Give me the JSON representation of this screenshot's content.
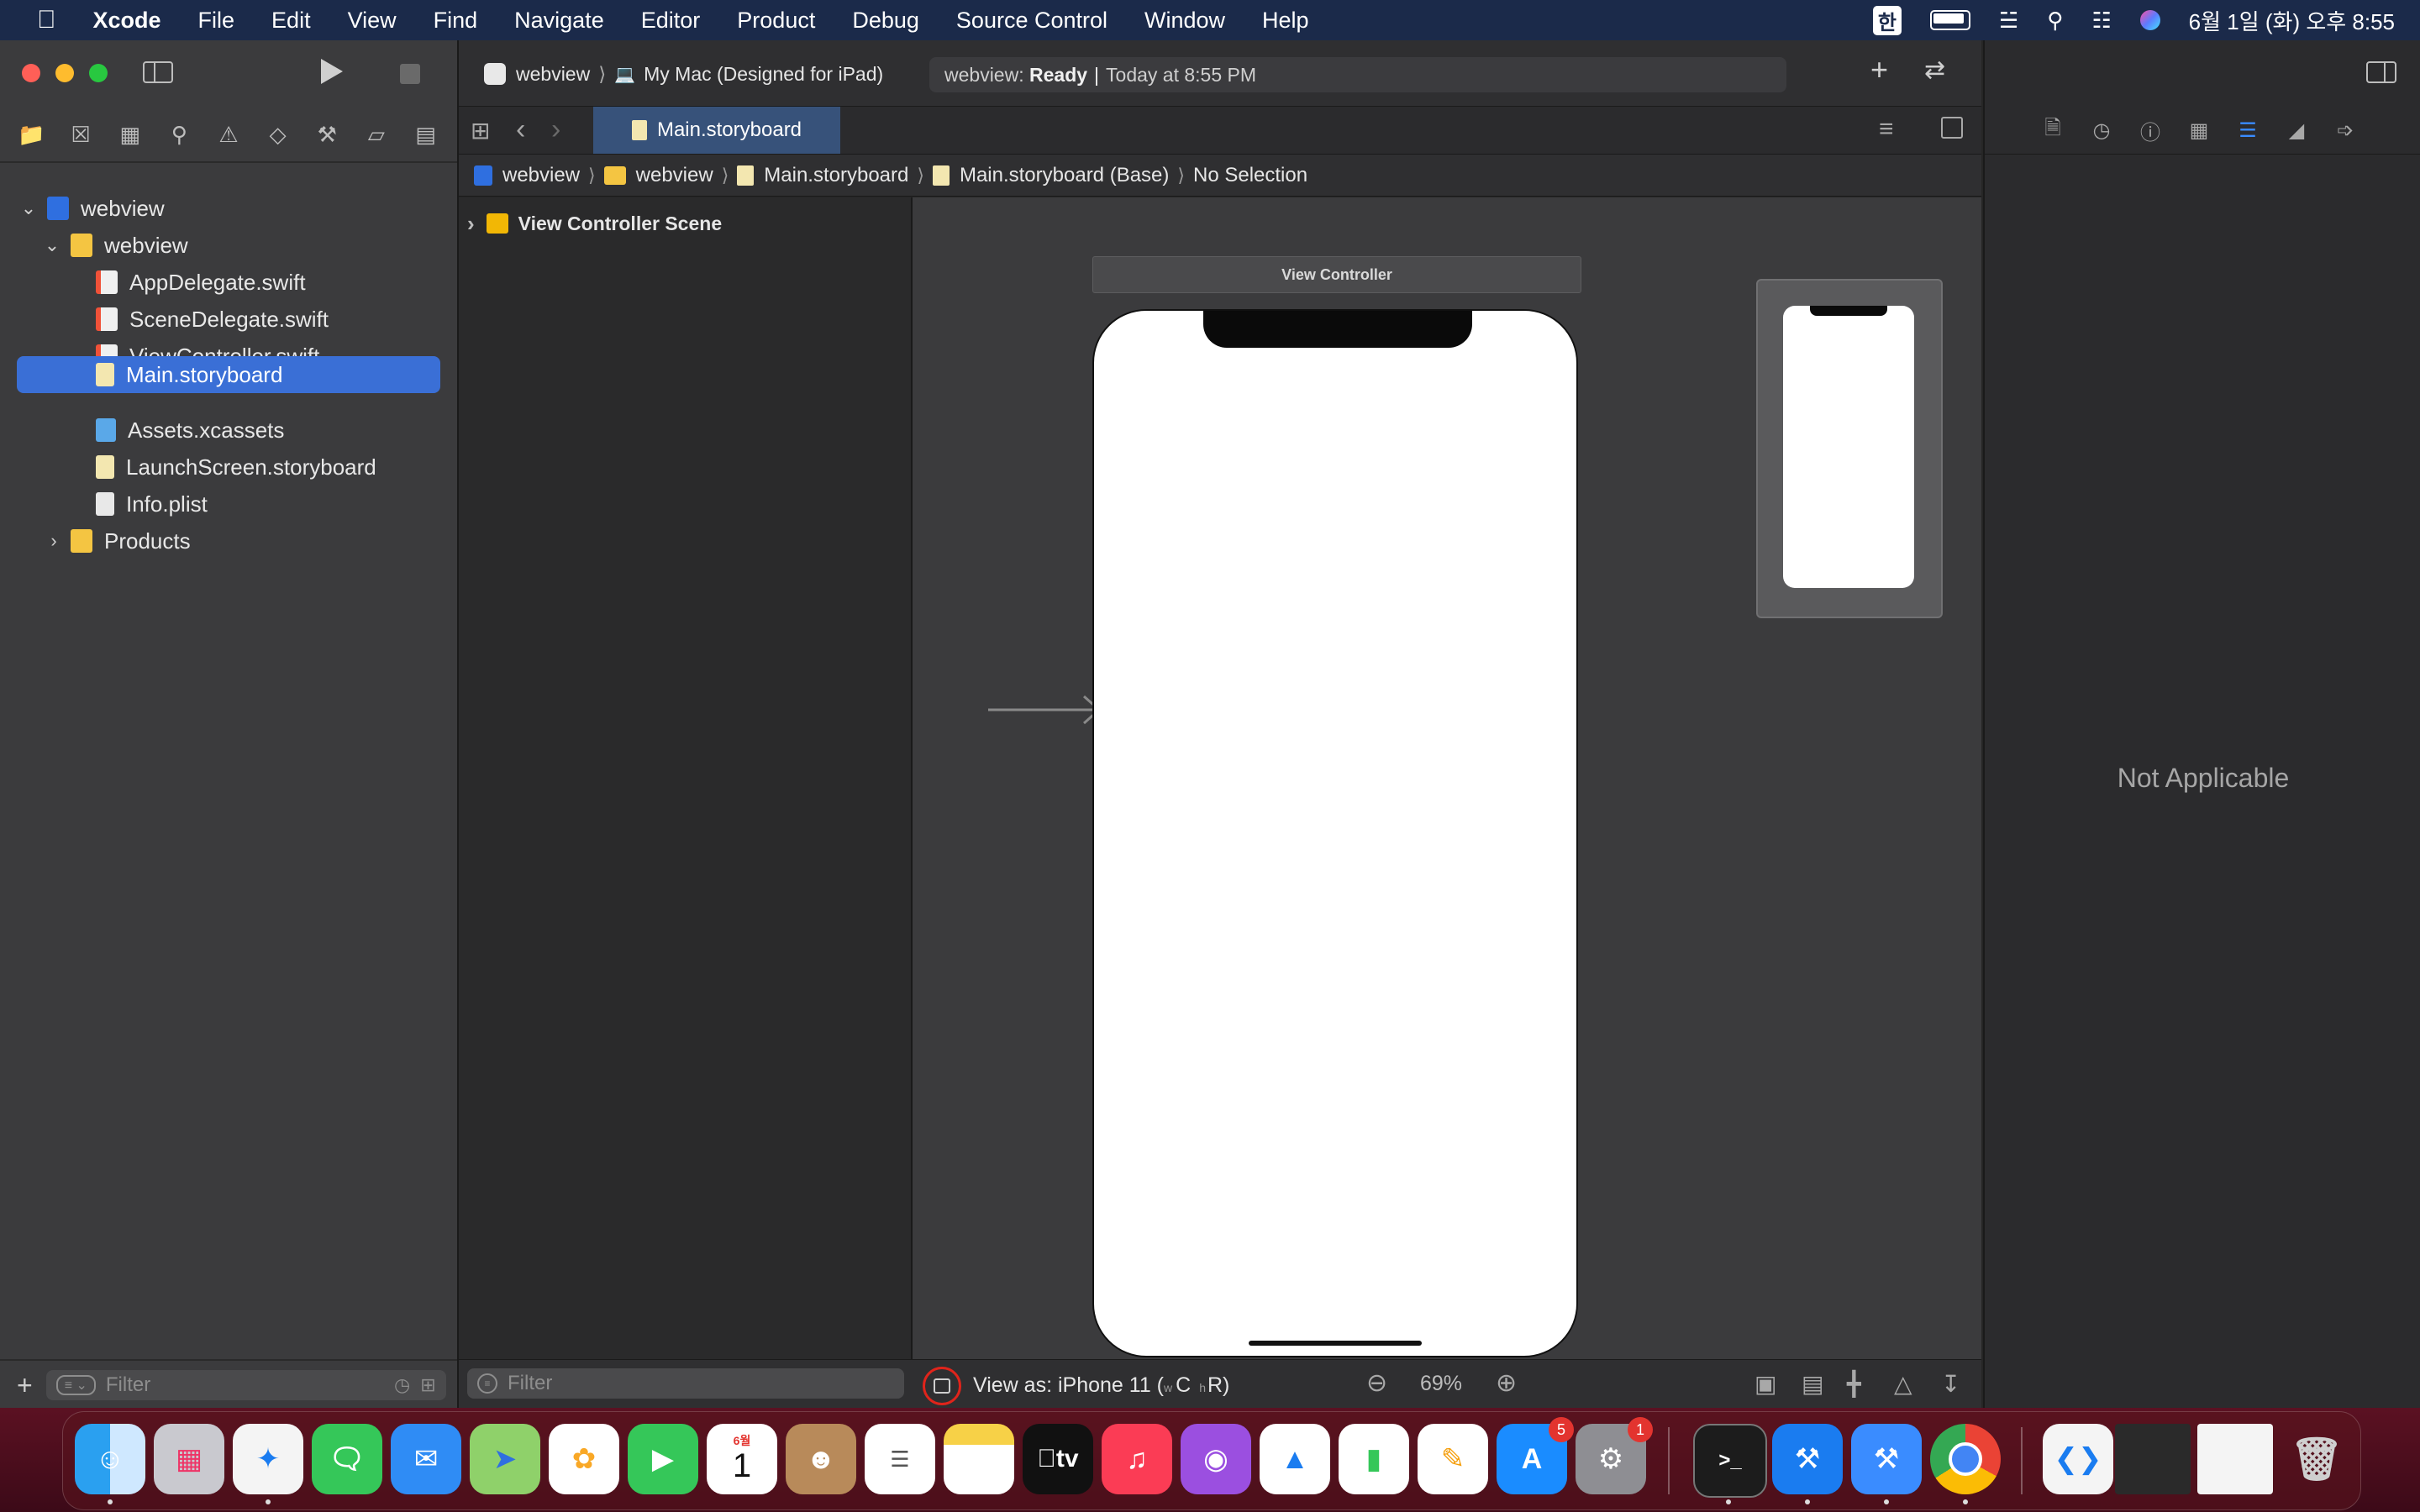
{
  "menubar": {
    "app": "Xcode",
    "items": [
      "File",
      "Edit",
      "View",
      "Find",
      "Navigate",
      "Editor",
      "Product",
      "Debug",
      "Source Control",
      "Window",
      "Help"
    ],
    "input_method": "한",
    "clock": "6월 1일 (화) 오후 8:55"
  },
  "toolbar": {
    "scheme": "webview",
    "destination": "My Mac (Designed for iPad)",
    "activity_project": "webview:",
    "activity_status": "Ready",
    "activity_time": "Today at 8:55 PM"
  },
  "tab": {
    "label": "Main.storyboard"
  },
  "jumpbar": {
    "items": [
      "webview",
      "webview",
      "Main.storyboard",
      "Main.storyboard (Base)",
      "No Selection"
    ]
  },
  "navigator": {
    "tree": [
      {
        "label": "webview",
        "kind": "project"
      },
      {
        "label": "webview",
        "kind": "folder"
      },
      {
        "label": "AppDelegate.swift",
        "kind": "swift"
      },
      {
        "label": "SceneDelegate.swift",
        "kind": "swift"
      },
      {
        "label": "ViewController.swift",
        "kind": "swift"
      },
      {
        "label": "Main.storyboard",
        "kind": "storyboard",
        "selected": true
      },
      {
        "label": "Assets.xcassets",
        "kind": "assets"
      },
      {
        "label": "LaunchScreen.storyboard",
        "kind": "storyboard"
      },
      {
        "label": "Info.plist",
        "kind": "plist"
      },
      {
        "label": "Products",
        "kind": "folder"
      }
    ],
    "filter_placeholder": "Filter"
  },
  "outline": {
    "scene": "View Controller Scene",
    "filter_placeholder": "Filter"
  },
  "canvas": {
    "scene_title": "View Controller",
    "view_as_prefix": "View as: iPhone 11 (",
    "view_as_w": "w",
    "view_as_c": "C",
    "view_as_h": "h",
    "view_as_r": "R)",
    "zoom": "69%"
  },
  "inspector": {
    "empty_text": "Not Applicable"
  },
  "dock": {
    "calendar_month": "6월",
    "calendar_day": "1",
    "appstore_badge": "5",
    "settings_badge": "1",
    "tv_label": "tv"
  }
}
